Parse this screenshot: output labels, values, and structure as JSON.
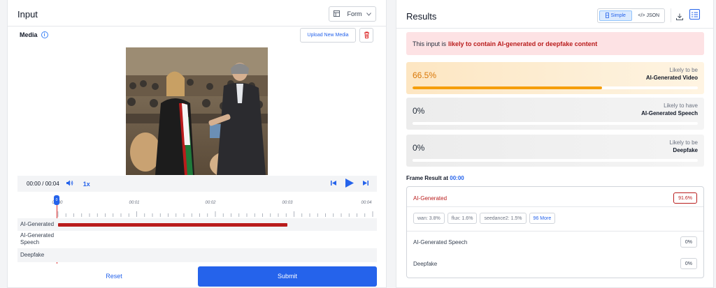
{
  "input_panel": {
    "title": "Input",
    "form_select": "Form",
    "media_label": "Media",
    "upload_label": "Upload New Media",
    "player": {
      "time": "00:00 / 00:04",
      "speed": "1x"
    },
    "timeline": {
      "ticks": [
        "00:00",
        "00:01",
        "00:02",
        "00:03",
        "00:04"
      ],
      "playhead_label": "0"
    },
    "tracks": [
      {
        "label": "AI-Generated"
      },
      {
        "label": "AI-Generated Speech"
      },
      {
        "label": "Deepfake"
      }
    ],
    "reset_label": "Reset",
    "submit_label": "Submit"
  },
  "results_panel": {
    "title": "Results",
    "view_simple": "Simple",
    "view_json": "</> JSON",
    "alert_prefix": "This input is",
    "alert_emphasis": "likely to contain AI-generated or deepfake content",
    "cards": [
      {
        "percent": "66.5%",
        "likely": "Likely to be",
        "category": "AI-Generated Video",
        "fill_fraction": 0.665
      },
      {
        "percent": "0%",
        "likely": "Likely to have",
        "category": "AI-Generated Speech",
        "fill_fraction": 0
      },
      {
        "percent": "0%",
        "likely": "Likely to be",
        "category": "Deepfake",
        "fill_fraction": 0
      }
    ],
    "frame_result_label": "Frame Result at",
    "frame_time": "00:00",
    "frame": {
      "ai_generated_label": "AI-Generated",
      "ai_generated_value": "91.6%",
      "chips": [
        "wan: 3.8%",
        "flux: 1.6%",
        "seedance2: 1.5%"
      ],
      "more_label": "96 More",
      "speech_label": "AI-Generated Speech",
      "speech_value": "0%",
      "deepfake_label": "Deepfake",
      "deepfake_value": "0%"
    }
  },
  "colors": {
    "accent": "#2563eb",
    "danger": "#b91c1c",
    "warning": "#f59e0b"
  }
}
